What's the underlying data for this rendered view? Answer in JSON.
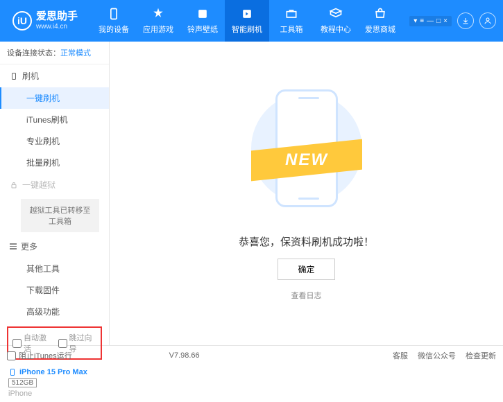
{
  "app": {
    "name": "爱思助手",
    "url": "www.i4.cn",
    "logo_letter": "iU"
  },
  "window_controls": {
    "menu": "▾",
    "tools": "≡",
    "min": "—",
    "max": "□",
    "close": "×"
  },
  "nav": [
    {
      "label": "我的设备"
    },
    {
      "label": "应用游戏"
    },
    {
      "label": "铃声壁纸"
    },
    {
      "label": "智能刷机"
    },
    {
      "label": "工具箱"
    },
    {
      "label": "教程中心"
    },
    {
      "label": "爱思商城"
    }
  ],
  "status": {
    "prefix": "设备连接状态：",
    "value": "正常模式"
  },
  "sidebar": {
    "flash": {
      "title": "刷机",
      "items": [
        "一键刷机",
        "iTunes刷机",
        "专业刷机",
        "批量刷机"
      ]
    },
    "jailbreak": {
      "title": "一键越狱",
      "notice": "越狱工具已转移至工具箱"
    },
    "more": {
      "title": "更多",
      "items": [
        "其他工具",
        "下载固件",
        "高级功能"
      ]
    }
  },
  "checkboxes": {
    "auto_activate": "自动激活",
    "skip_guide": "跳过向导"
  },
  "device": {
    "name": "iPhone 15 Pro Max",
    "storage": "512GB",
    "type": "iPhone"
  },
  "main": {
    "ribbon": "NEW",
    "message": "恭喜您，保资料刷机成功啦！",
    "ok": "确定",
    "view_log": "查看日志"
  },
  "footer": {
    "block_itunes": "阻止iTunes运行",
    "version": "V7.98.66",
    "links": [
      "客服",
      "微信公众号",
      "检查更新"
    ]
  }
}
